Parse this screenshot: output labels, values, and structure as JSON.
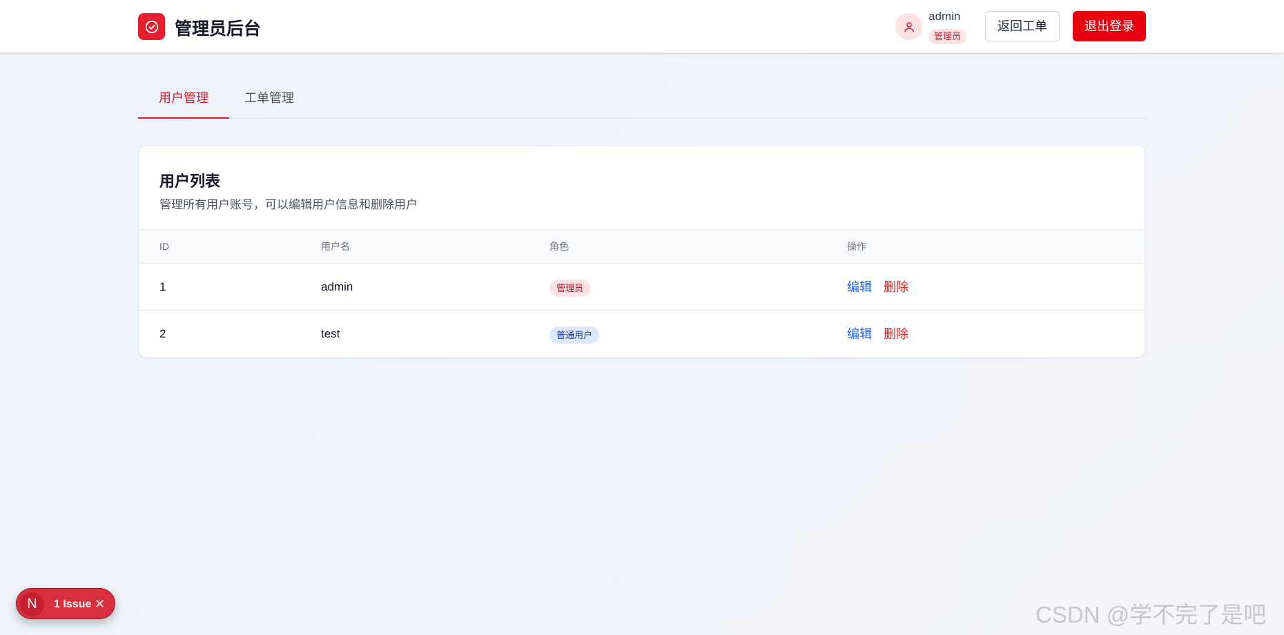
{
  "header": {
    "title": "管理员后台",
    "user": {
      "name": "admin",
      "role": "管理员"
    },
    "back_label": "返回工单",
    "logout_label": "退出登录"
  },
  "tabs": [
    {
      "label": "用户管理",
      "active": true
    },
    {
      "label": "工单管理",
      "active": false
    }
  ],
  "card": {
    "title": "用户列表",
    "subtitle": "管理所有用户账号，可以编辑用户信息和删除用户"
  },
  "table": {
    "columns": [
      "ID",
      "用户名",
      "角色",
      "操作"
    ],
    "rows": [
      {
        "id": "1",
        "username": "admin",
        "role": "管理员",
        "role_type": "admin",
        "edit": "编辑",
        "delete": "删除"
      },
      {
        "id": "2",
        "username": "test",
        "role": "普通用户",
        "role_type": "user",
        "edit": "编辑",
        "delete": "删除"
      }
    ]
  },
  "issue_badge": {
    "letter": "N",
    "label": "1 Issue"
  },
  "watermark": "CSDN @学不完了是吧",
  "colors": {
    "primary": "#e8000f",
    "link": "#2563eb",
    "danger": "#dc2626"
  },
  "icons": {
    "logo": "check-circle-icon",
    "avatar": "user-icon",
    "close": "close-icon"
  }
}
